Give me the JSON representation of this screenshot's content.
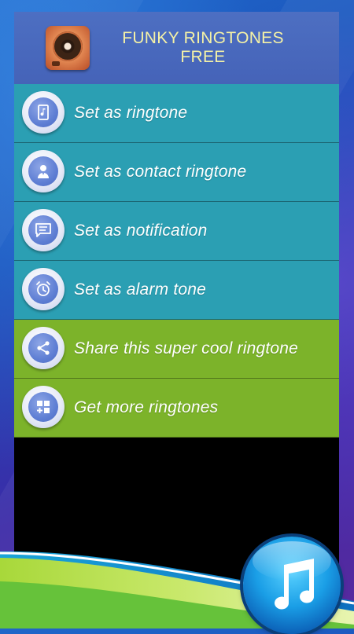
{
  "header": {
    "title": "FUNKY RINGTONES\nFREE"
  },
  "menu": {
    "items": [
      {
        "label": "Set as ringtone",
        "icon": "music-file-icon",
        "color": "#2b9fb3"
      },
      {
        "label": "Set as contact ringtone",
        "icon": "contact-icon",
        "color": "#2b9fb3"
      },
      {
        "label": "Set as notification",
        "icon": "message-icon",
        "color": "#2b9fb3"
      },
      {
        "label": "Set as alarm tone",
        "icon": "alarm-clock-icon",
        "color": "#2b9fb3"
      },
      {
        "label": "Share this super cool ringtone",
        "icon": "share-icon",
        "color": "#7cb32a"
      },
      {
        "label": "Get more ringtones",
        "icon": "apps-grid-icon",
        "color": "#7cb32a"
      }
    ]
  },
  "floating_button": {
    "icon": "music-note-icon"
  },
  "colors": {
    "accent_teal": "#2b9fb3",
    "accent_green": "#7cb32a",
    "header": "#4d6fc2",
    "title_text": "#f5f2a6"
  }
}
